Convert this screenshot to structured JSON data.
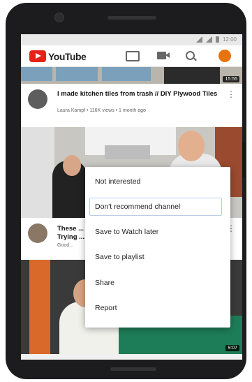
{
  "status_bar": {
    "time": "12:00"
  },
  "app_bar": {
    "brand": "YouTube",
    "icons": [
      "cast-icon",
      "camera-icon",
      "search-icon",
      "account-avatar"
    ]
  },
  "top_video": {
    "duration": "15:55"
  },
  "videos": [
    {
      "title": "I made kitchen tiles from trash // DIY Plywood Tiles",
      "meta": "Laura Kampf • 116K views • 1 month ago"
    },
    {
      "title": "These ... Trying ...",
      "meta": "Good..."
    }
  ],
  "bottom_video": {
    "duration": "9:07"
  },
  "context_menu": {
    "items": [
      {
        "label": "Not interested"
      },
      {
        "label": "Don't recommend channel"
      },
      {
        "label": "Save to Watch later"
      },
      {
        "label": "Save to playlist"
      },
      {
        "label": "Share"
      },
      {
        "label": "Report"
      }
    ]
  },
  "colors": {
    "brand_red": "#e62117",
    "highlight_border": "#b9cde6"
  }
}
